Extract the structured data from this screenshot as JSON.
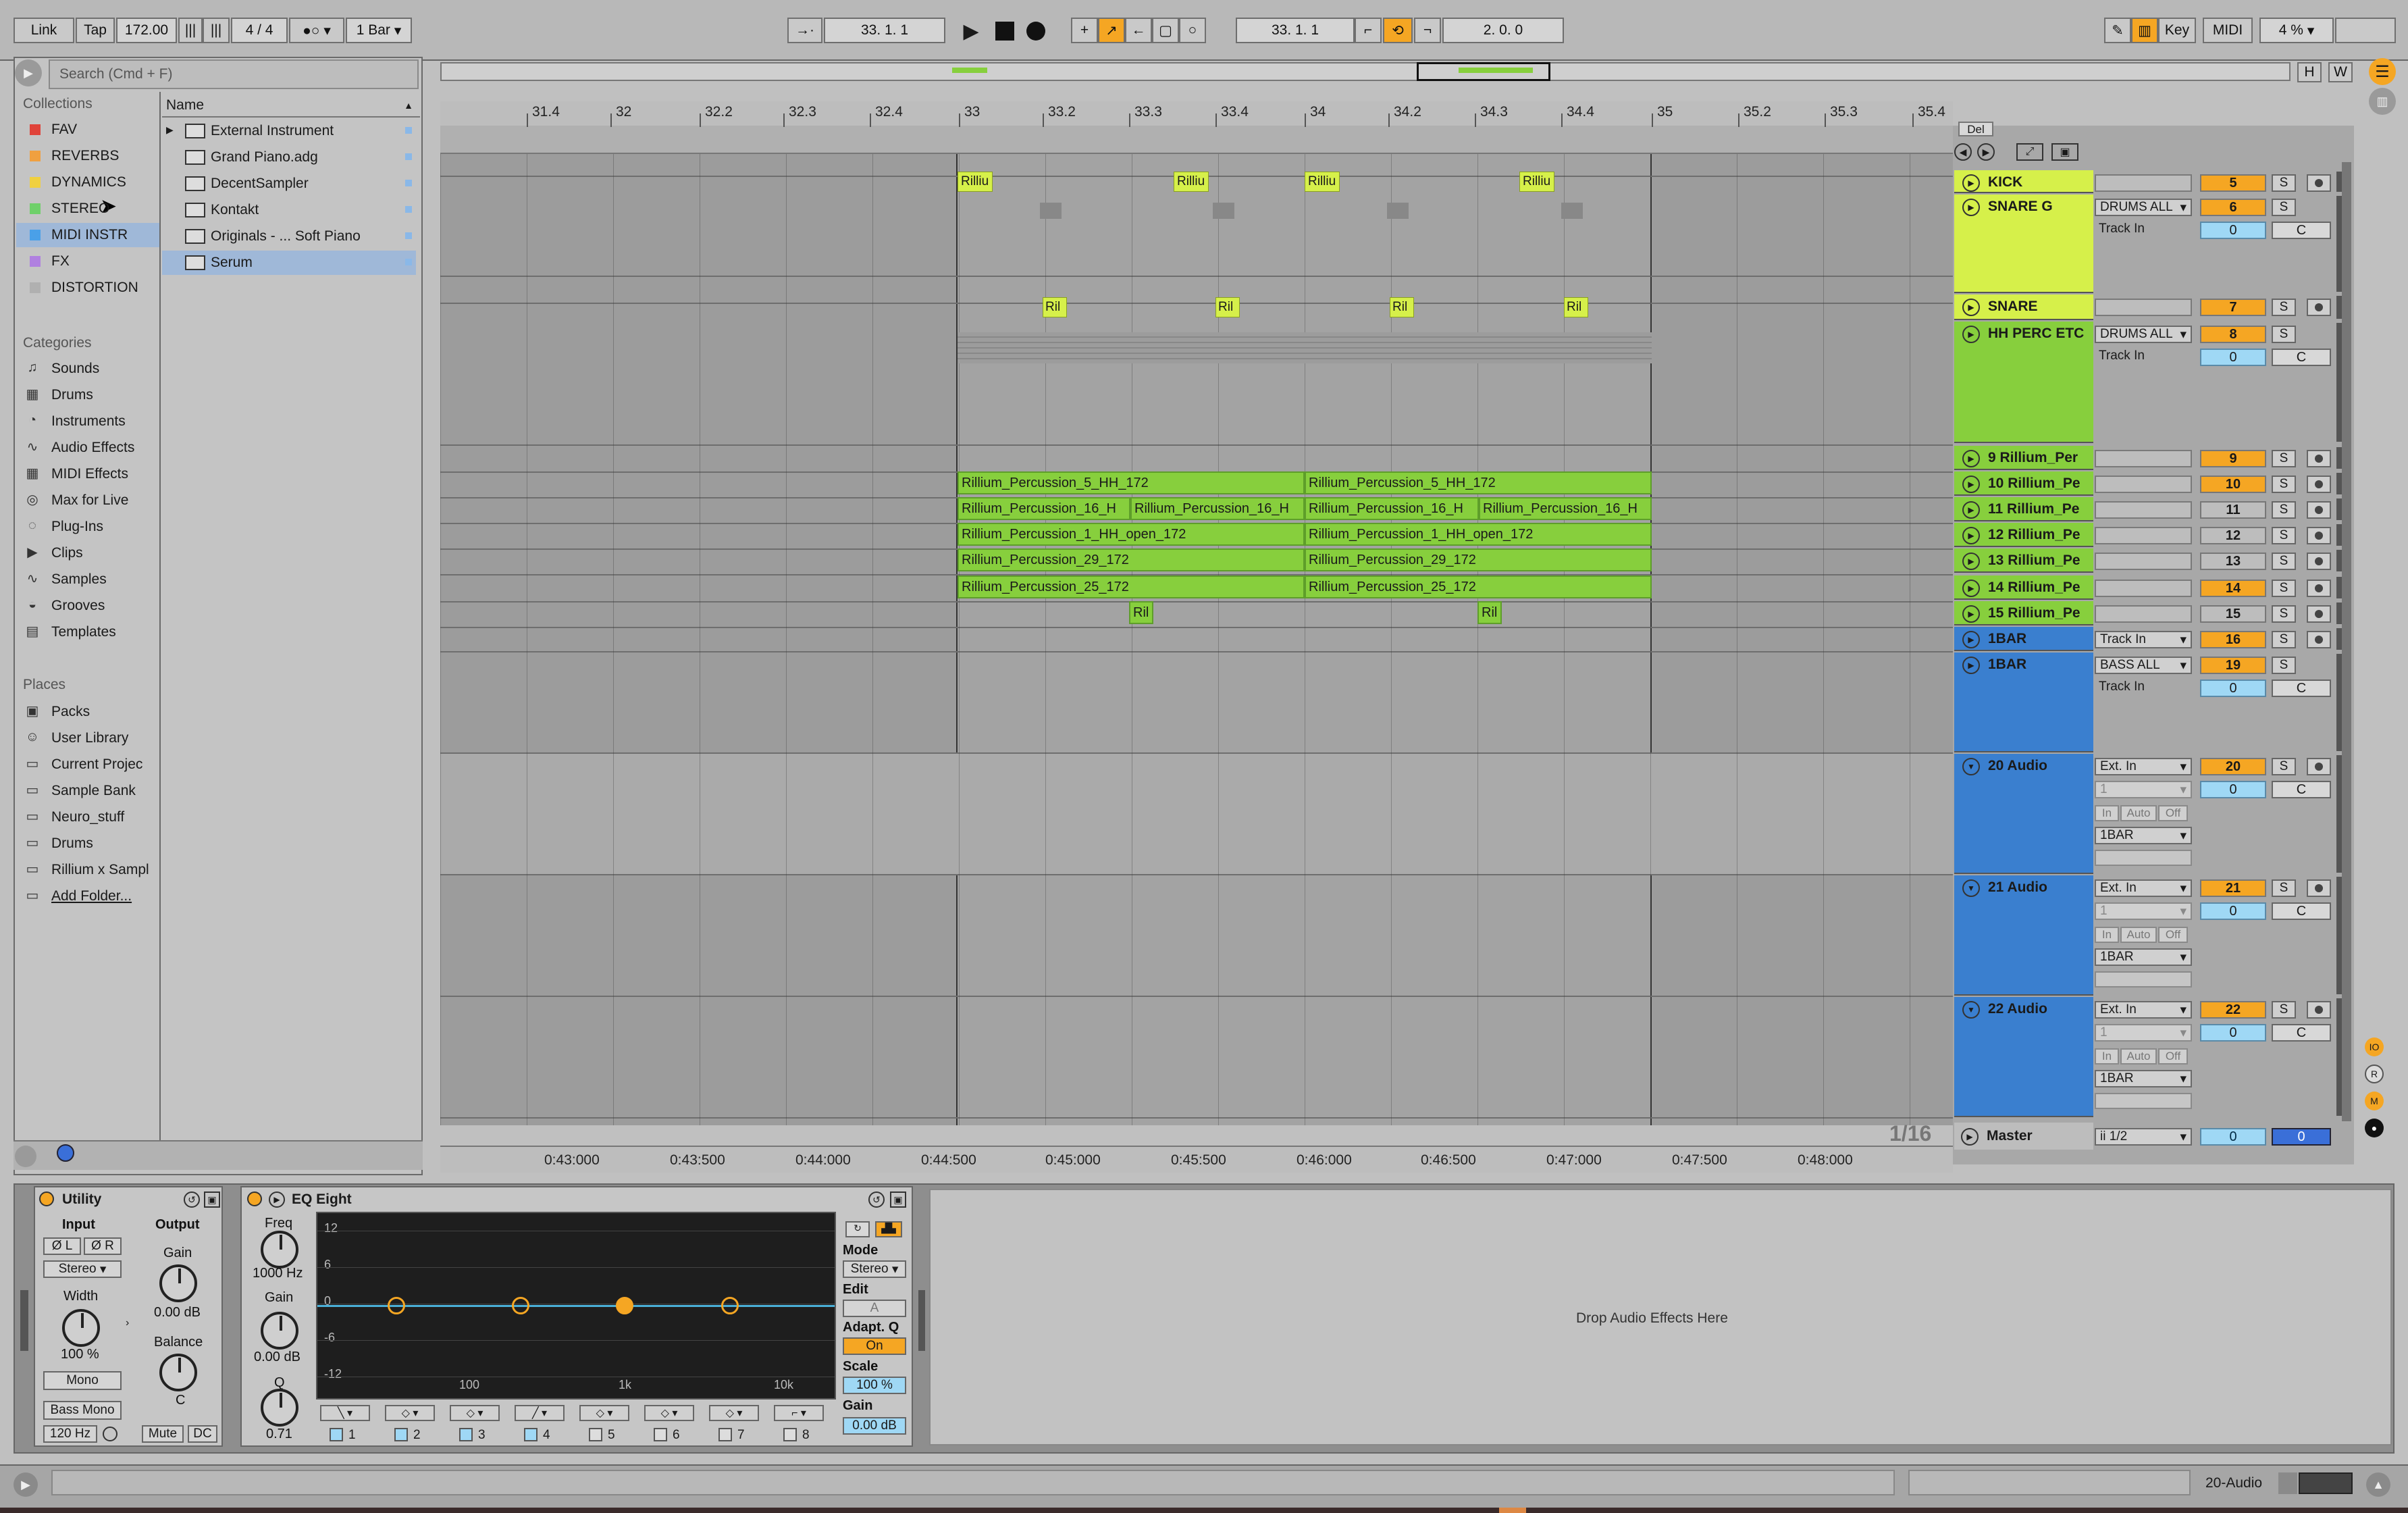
{
  "toolbar": {
    "link": "Link",
    "tap": "Tap",
    "tempo": "172.00",
    "sig": "4 / 4",
    "quant": "1 Bar",
    "pos": "33.   1.   1",
    "loop_start": "33.   1.   1",
    "loop_len": "2.   0.   0",
    "key": "Key",
    "midi": "MIDI",
    "cpu": "4 %"
  },
  "browser": {
    "search_placeholder": "Search (Cmd + F)",
    "collections_title": "Collections",
    "collections": [
      {
        "label": "FAV",
        "color": "#e0433a"
      },
      {
        "label": "REVERBS",
        "color": "#f0a040"
      },
      {
        "label": "DYNAMICS",
        "color": "#f0d040"
      },
      {
        "label": "STEREO",
        "color": "#6fd06a"
      },
      {
        "label": "MIDI INSTR",
        "color": "#4aa0e8"
      },
      {
        "label": "FX",
        "color": "#b080e0"
      },
      {
        "label": "DISTORTION",
        "color": "#b0b0b0"
      }
    ],
    "categories_title": "Categories",
    "categories": [
      {
        "label": "Sounds",
        "icon": "music-note-icon"
      },
      {
        "label": "Drums",
        "icon": "drum-grid-icon"
      },
      {
        "label": "Instruments",
        "icon": "clock-icon"
      },
      {
        "label": "Audio Effects",
        "icon": "waveform-icon"
      },
      {
        "label": "MIDI Effects",
        "icon": "midi-grid-icon"
      },
      {
        "label": "Max for Live",
        "icon": "m4l-icon"
      },
      {
        "label": "Plug-Ins",
        "icon": "plug-icon"
      },
      {
        "label": "Clips",
        "icon": "play-icon"
      },
      {
        "label": "Samples",
        "icon": "waveform-icon"
      },
      {
        "label": "Grooves",
        "icon": "groove-icon"
      },
      {
        "label": "Templates",
        "icon": "template-icon"
      }
    ],
    "places_title": "Places",
    "places": [
      {
        "label": "Packs",
        "icon": "package-icon"
      },
      {
        "label": "User Library",
        "icon": "user-icon"
      },
      {
        "label": "Current Projec",
        "icon": "folder-icon"
      },
      {
        "label": "Sample Bank",
        "icon": "folder-icon"
      },
      {
        "label": "Neuro_stuff",
        "icon": "folder-icon"
      },
      {
        "label": "Drums",
        "icon": "folder-icon"
      },
      {
        "label": "Rillium x Sampl",
        "icon": "folder-icon"
      },
      {
        "label": "Add Folder...",
        "icon": "add-folder-icon"
      }
    ],
    "name_header": "Name",
    "files": [
      "External Instrument",
      "Grand Piano.adg",
      "DecentSampler",
      "Kontakt",
      "Originals - ... Soft Piano",
      "Serum"
    ]
  },
  "arrangement": {
    "ruler": [
      "31.4",
      "32",
      "32.2",
      "32.3",
      "32.4",
      "33",
      "33.2",
      "33.3",
      "33.4",
      "34",
      "34.2",
      "34.3",
      "34.4",
      "35",
      "35.2",
      "35.3",
      "35.4"
    ],
    "loop_marker": "1",
    "times": [
      "0:43:000",
      "0:43:500",
      "0:44:000",
      "0:44:500",
      "0:45:000",
      "0:45:500",
      "0:46:000",
      "0:46:500",
      "0:47:000",
      "0:47:500",
      "0:48:000"
    ],
    "grid": "1/16",
    "kick_clips": [
      "Rilliu",
      "Rilliu",
      "Rilliu",
      "Rilliu"
    ],
    "snare_clips": [
      "Ril",
      "Ril",
      "Ril",
      "Ril"
    ],
    "perc10": [
      "Rillium_Percussion_5_HH_172",
      "Rillium_Percussion_5_HH_172"
    ],
    "perc11": [
      "Rillium_Percussion_16_H",
      "Rillium_Percussion_16_H",
      "Rillium_Percussion_16_H",
      "Rillium_Percussion_16_H"
    ],
    "perc12": [
      "Rillium_Percussion_1_HH_open_172",
      "Rillium_Percussion_1_HH_open_172"
    ],
    "perc13": [
      "Rillium_Percussion_29_172",
      "Rillium_Percussion_29_172"
    ],
    "perc14": [
      "Rillium_Percussion_25_172",
      "Rillium_Percussion_25_172"
    ],
    "perc15": [
      "Ril",
      "Ril"
    ]
  },
  "tracks": {
    "del": "Del",
    "kick": {
      "name": "KICK",
      "num": "5"
    },
    "snareg": {
      "name": "SNARE G",
      "in": "DRUMS ALL",
      "mon": "Track In",
      "num": "6",
      "vol": "0",
      "pan": "C"
    },
    "snare": {
      "name": "SNARE",
      "num": "7"
    },
    "hh": {
      "name": "HH PERC ETC",
      "in": "DRUMS ALL",
      "mon": "Track In",
      "num": "8",
      "vol": "0",
      "pan": "C"
    },
    "t9": {
      "name": "9 Rillium_Per",
      "num": "9"
    },
    "t10": {
      "name": "10 Rillium_Pe",
      "num": "10"
    },
    "t11": {
      "name": "11 Rillium_Pe",
      "num": "11"
    },
    "t12": {
      "name": "12 Rillium_Pe",
      "num": "12"
    },
    "t13": {
      "name": "13 Rillium_Pe",
      "num": "13"
    },
    "t14": {
      "name": "14 Rillium_Pe",
      "num": "14"
    },
    "t15": {
      "name": "15 Rillium_Pe",
      "num": "15"
    },
    "b1": {
      "name": "1BAR",
      "in": "Track In",
      "num": "16"
    },
    "b2": {
      "name": "1BAR",
      "in": "BASS ALL",
      "mon": "Track In",
      "num": "19",
      "vol": "0",
      "pan": "C"
    },
    "a20": {
      "name": "20 Audio",
      "in": "Ext. In",
      "ch": "1",
      "num": "20",
      "vol": "0",
      "pan": "C",
      "mon_in": "In",
      "mon_auto": "Auto",
      "mon_off": "Off",
      "out": "1BAR"
    },
    "a21": {
      "name": "21 Audio",
      "in": "Ext. In",
      "ch": "1",
      "num": "21",
      "vol": "0",
      "pan": "C",
      "mon_in": "In",
      "mon_auto": "Auto",
      "mon_off": "Off",
      "out": "1BAR"
    },
    "a22": {
      "name": "22 Audio",
      "in": "Ext. In",
      "ch": "1",
      "num": "22",
      "vol": "0",
      "pan": "C",
      "mon_in": "In",
      "mon_auto": "Auto",
      "mon_off": "Off",
      "out": "1BAR"
    },
    "master": {
      "name": "Master",
      "out": "ii 1/2",
      "vol": "0",
      "pan": "0"
    },
    "solo": "S"
  },
  "devices": {
    "utility": {
      "title": "Utility",
      "input": "Input",
      "output": "Output",
      "phase_l": "Ø L",
      "phase_r": "Ø R",
      "mode": "Stereo",
      "gain": "Gain",
      "gain_val": "0.00 dB",
      "width": "Width",
      "width_val": "100 %",
      "balance": "Balance",
      "balance_val": "C",
      "mono": "Mono",
      "bass_mono": "Bass Mono",
      "bass_freq": "120 Hz",
      "mute": "Mute",
      "dc": "DC"
    },
    "eq": {
      "title": "EQ Eight",
      "freq": "Freq",
      "freq_val": "1000 Hz",
      "gain": "Gain",
      "gain_val": "0.00 dB",
      "q": "Q",
      "q_val": "0.71",
      "db_labels": [
        "12",
        "6",
        "0",
        "-6",
        "-12"
      ],
      "hz_labels": [
        "100",
        "1k",
        "10k"
      ],
      "mode": "Mode",
      "mode_val": "Stereo",
      "edit": "Edit",
      "edit_val": "A",
      "adapt": "Adapt. Q",
      "adapt_val": "On",
      "scale": "Scale",
      "scale_val": "100 %",
      "gain2": "Gain",
      "gain2_val": "0.00 dB",
      "bands": [
        "1",
        "2",
        "3",
        "4",
        "5",
        "6",
        "7",
        "8"
      ]
    },
    "drop": "Drop Audio Effects Here"
  },
  "status": {
    "track": "20-Audio"
  }
}
